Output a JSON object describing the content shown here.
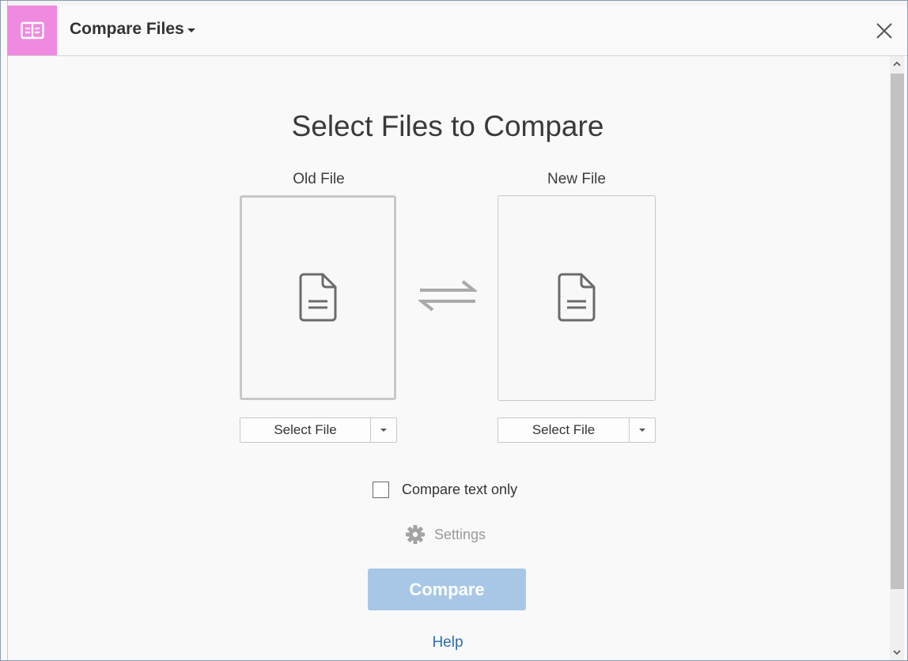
{
  "header": {
    "title": "Compare Files",
    "badge_color": "#f08ae0",
    "badge_icon": "compare-files-icon",
    "close_icon": "close-icon"
  },
  "main": {
    "title": "Select Files to Compare",
    "old_file": {
      "label": "Old File",
      "select_button_label": "Select File",
      "icon": "document-icon"
    },
    "new_file": {
      "label": "New File",
      "select_button_label": "Select File",
      "icon": "document-icon"
    },
    "swap_icon": "swap-arrows-icon",
    "compare_text_only": {
      "label": "Compare text only",
      "checked": false
    },
    "settings": {
      "label": "Settings",
      "icon": "gear-icon",
      "enabled": false
    },
    "compare_button": {
      "label": "Compare",
      "enabled": false,
      "color": "#a8c7e6"
    },
    "help_link": "Help"
  },
  "colors": {
    "link": "#2d6db5",
    "background": "#f9f9f9"
  }
}
